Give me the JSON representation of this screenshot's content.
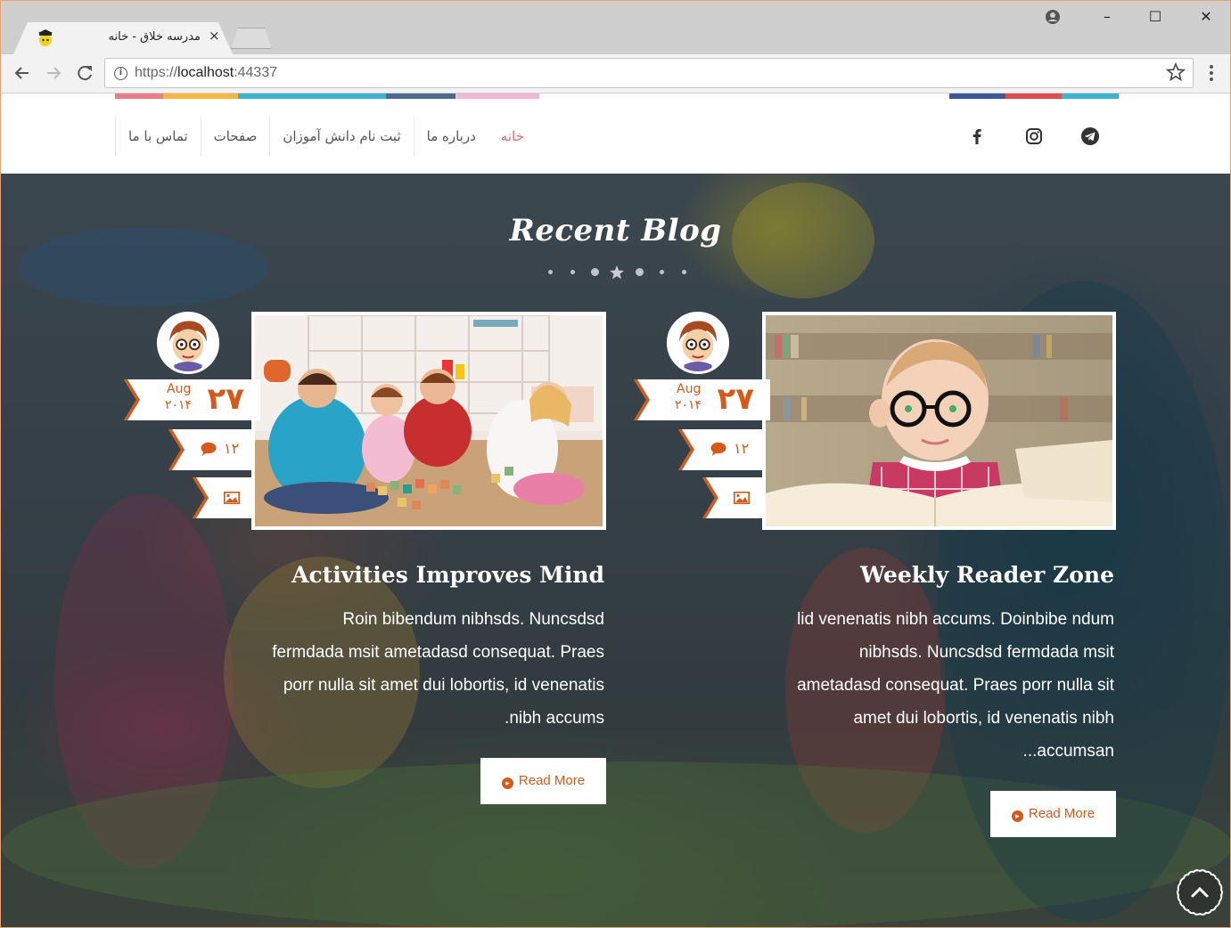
{
  "browser": {
    "tab_title": "مدرسه خلاق - خانه",
    "tab_close": "×",
    "url_scheme": "https://",
    "url_host": "localhost",
    "url_port": ":44337",
    "controls": {
      "minimize": "–",
      "maximize": "☐",
      "close": "✕"
    },
    "icons": [
      "back-arrow-icon",
      "forward-arrow-icon",
      "reload-icon",
      "info-icon",
      "bookmark-star-icon",
      "menu-dots-icon",
      "profile-icon"
    ]
  },
  "theme": {
    "accent": "#d35a1a",
    "active_menu": "#e46a6a",
    "colorbar": [
      "#e87e86",
      "#f5b93e",
      "#3cb3d0",
      "#4a6b8c",
      "#f3b6d6",
      "#3b5998",
      "#e04b4b",
      "#3cb3d0"
    ]
  },
  "nav": {
    "items": [
      "خانه",
      "درباره ما",
      "ثبت نام دانش آموزان",
      "صفحات",
      "تماس با ما"
    ],
    "active_index": 0,
    "social": [
      "telegram-icon",
      "instagram-icon",
      "facebook-icon"
    ]
  },
  "section": {
    "title": "Recent Blog"
  },
  "posts": [
    {
      "title": "Weekly Reader Zone",
      "excerpt_lines": [
        "lid venenatis nibh accums. Doinbibe ndum",
        "nibhsds. Nuncsdsd fermdada msit",
        "ametadasd consequat. Praes porr nulla sit",
        "amet dui lobortis, id venenatis nibh",
        "accumsan..."
      ],
      "day": "۲۷",
      "month": "Aug",
      "year": "۲۰۱۴",
      "comments": "۱۲",
      "read_more": "Read More",
      "photo": "baby-with-glasses-reading"
    },
    {
      "title": "Activities Improves Mind",
      "excerpt_lines": [
        "Roin bibendum nibhsds. Nuncsdsd",
        "fermdada msit ametadasd consequat. Praes",
        "porr nulla sit amet dui lobortis, id venenatis",
        "nibh accums."
      ],
      "day": "۲۷",
      "month": "Aug",
      "year": "۲۰۱۴",
      "comments": "۱۲",
      "read_more": "Read More",
      "photo": "kids-playing-with-blocks"
    }
  ]
}
